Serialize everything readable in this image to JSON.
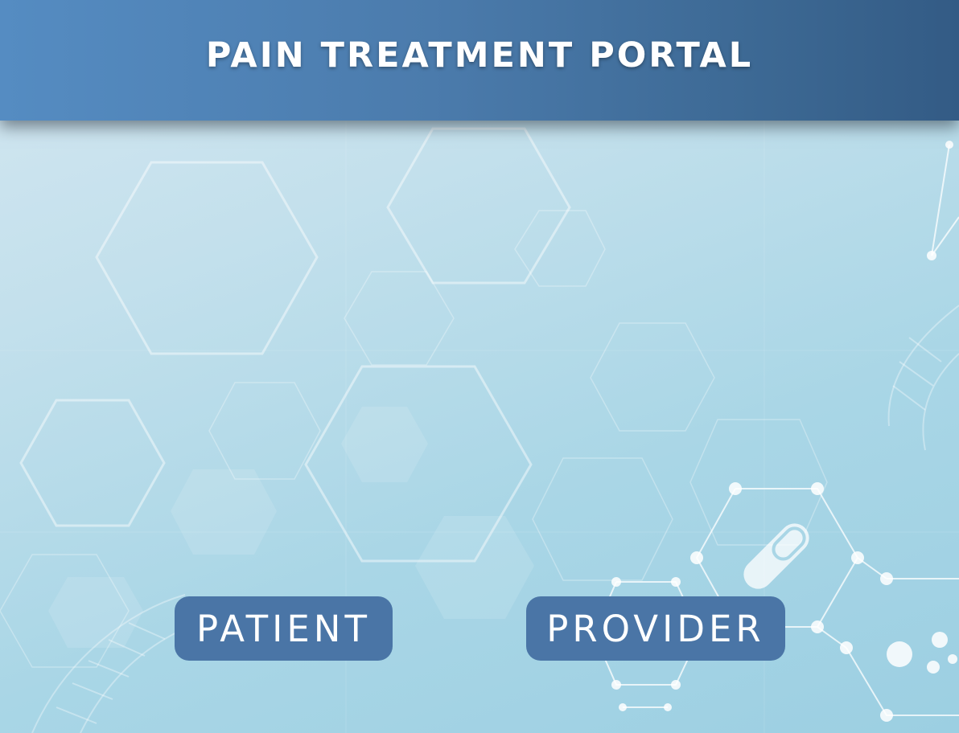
{
  "header": {
    "title": "PAIN TREATMENT PORTAL"
  },
  "buttons": {
    "patient_label": "PATIENT",
    "provider_label": "PROVIDER"
  },
  "icons": {
    "background": "hexagon-molecule-pattern",
    "pill": "capsule-icon",
    "dna": "dna-helix-icon"
  },
  "colors": {
    "header_start": "#558cc2",
    "header_end": "#335b85",
    "button": "#4a75a6",
    "text": "#ffffff"
  }
}
